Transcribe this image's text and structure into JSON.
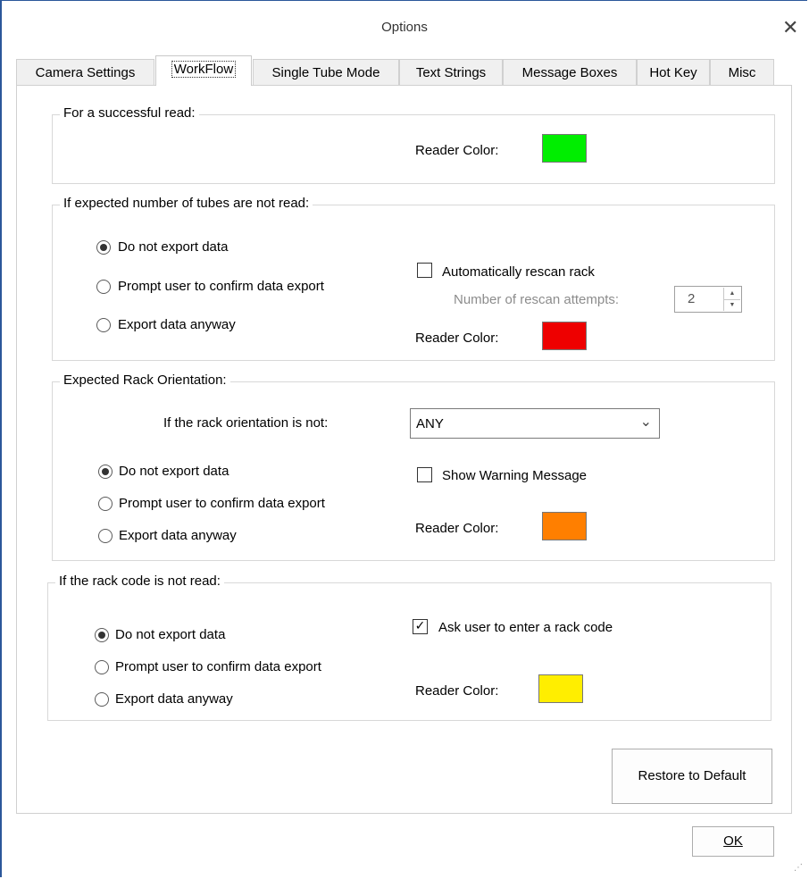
{
  "window": {
    "title": "Options",
    "close_glyph": "✕"
  },
  "tabs": [
    {
      "label": "Camera Settings"
    },
    {
      "label": "WorkFlow"
    },
    {
      "label": "Single Tube Mode"
    },
    {
      "label": "Text Strings"
    },
    {
      "label": "Message Boxes"
    },
    {
      "label": "Hot Key"
    },
    {
      "label": "Misc"
    }
  ],
  "active_tab": "WorkFlow",
  "sections": {
    "success": {
      "legend": "For a successful read:",
      "reader_color_label": "Reader Color:",
      "reader_color": "#00ee00"
    },
    "tubes": {
      "legend": "If expected number of tubes are not read:",
      "options": [
        "Do not export data",
        "Prompt user to confirm data export",
        "Export data anyway"
      ],
      "selected_index": 0,
      "rescan_label": "Automatically rescan rack",
      "rescan_checked": false,
      "attempts_label": "Number of rescan attempts:",
      "attempts_value": "2",
      "reader_color_label": "Reader Color:",
      "reader_color": "#ee0000"
    },
    "orientation": {
      "legend": "Expected Rack Orientation:",
      "if_label": "If the rack orientation is not:",
      "select_value": "ANY",
      "options": [
        "Do not export data",
        "Prompt user to confirm data export",
        "Export data anyway"
      ],
      "selected_index": 0,
      "warning_label": "Show Warning Message",
      "warning_checked": false,
      "reader_color_label": "Reader Color:",
      "reader_color": "#ff7f00"
    },
    "rackcode": {
      "legend": "If the rack code is not read:",
      "options": [
        "Do not export data",
        "Prompt user to confirm data export",
        "Export data anyway"
      ],
      "selected_index": 0,
      "ask_label": "Ask user to enter a rack code",
      "ask_checked": true,
      "reader_color_label": "Reader Color:",
      "reader_color": "#ffee00"
    }
  },
  "buttons": {
    "restore": "Restore to Default",
    "ok": "OK"
  }
}
